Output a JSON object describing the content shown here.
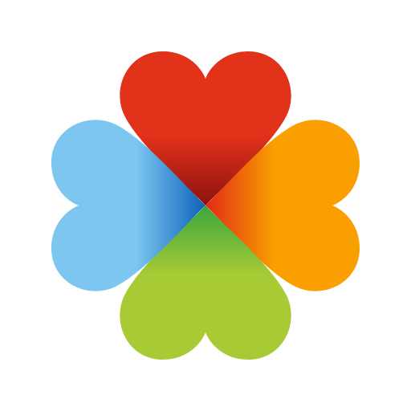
{
  "logo": {
    "icon": "four-heart-clover-logo",
    "petals": [
      {
        "name": "top",
        "icon": "red-heart-icon",
        "color_outer": "#e2321a",
        "color_inner": "#8e1210"
      },
      {
        "name": "right",
        "icon": "orange-heart-icon",
        "color_outer": "#f9a000",
        "color_inner": "#e22a16"
      },
      {
        "name": "bottom",
        "icon": "green-heart-icon",
        "color_outer": "#a8cb35",
        "color_inner": "#3aa63d"
      },
      {
        "name": "left",
        "icon": "blue-heart-icon",
        "color_outer": "#7cc6f0",
        "color_inner": "#0d62b8"
      }
    ],
    "background": "#ffffff"
  }
}
